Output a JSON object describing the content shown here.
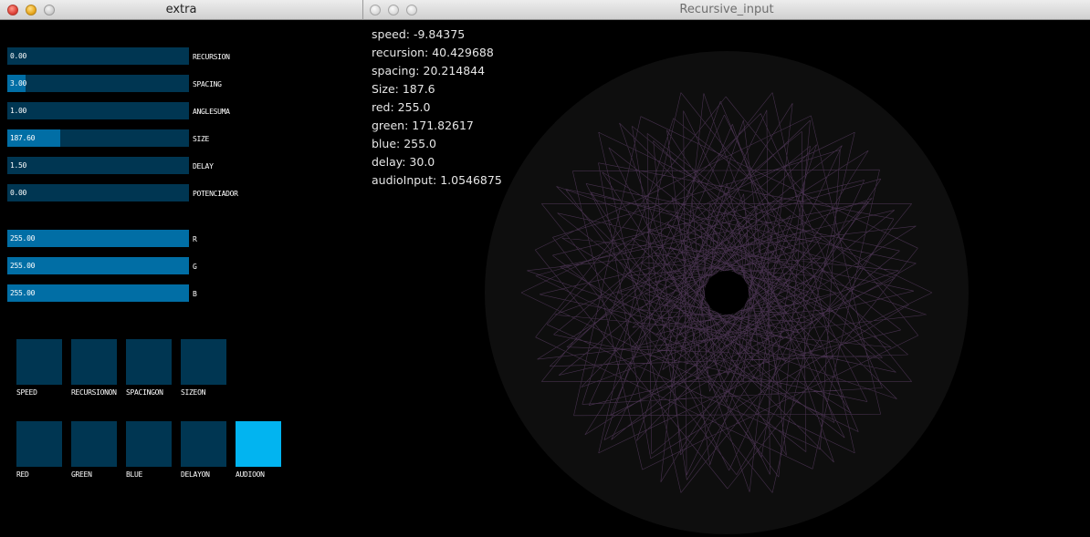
{
  "left_window": {
    "title": "extra",
    "sliders": [
      {
        "value": "0.00",
        "label": "RECURSION",
        "fill": 0
      },
      {
        "value": "3.00",
        "label": "SPACING",
        "fill": 0.1
      },
      {
        "value": "1.00",
        "label": "ANGLESUMA",
        "fill": 0
      },
      {
        "value": "187.60",
        "label": "SIZE",
        "fill": 0.29
      },
      {
        "value": "1.50",
        "label": "DELAY",
        "fill": 0
      },
      {
        "value": "0.00",
        "label": "POTENCIADOR",
        "fill": 0
      },
      {
        "value": "255.00",
        "label": "R",
        "fill": 1
      },
      {
        "value": "255.00",
        "label": "G",
        "fill": 1
      },
      {
        "value": "255.00",
        "label": "B",
        "fill": 1
      }
    ],
    "toggles_row1": [
      {
        "label": "SPEED",
        "on": false
      },
      {
        "label": "RECURSIONON",
        "on": false
      },
      {
        "label": "SPACINGON",
        "on": false
      },
      {
        "label": "SIZEON",
        "on": false
      }
    ],
    "toggles_row2": [
      {
        "label": "RED",
        "on": false
      },
      {
        "label": "GREEN",
        "on": false
      },
      {
        "label": "BLUE",
        "on": false
      },
      {
        "label": "DELAYON",
        "on": false
      },
      {
        "label": "AUDIOON",
        "on": true
      }
    ]
  },
  "right_window": {
    "title": "Recursive_input",
    "readout": [
      "speed: -9.84375",
      "recursion: 40.429688",
      "spacing: 20.214844",
      "Size: 187.6",
      "red: 255.0",
      "green: 171.82617",
      "blue: 255.0",
      "delay: 30.0",
      "audioInput: 1.0546875"
    ],
    "stroke_color": "#d78cf0"
  },
  "colors": {
    "slider_bg": "#003652",
    "slider_fill": "#016ea5",
    "toggle_on": "#02b4f0"
  }
}
